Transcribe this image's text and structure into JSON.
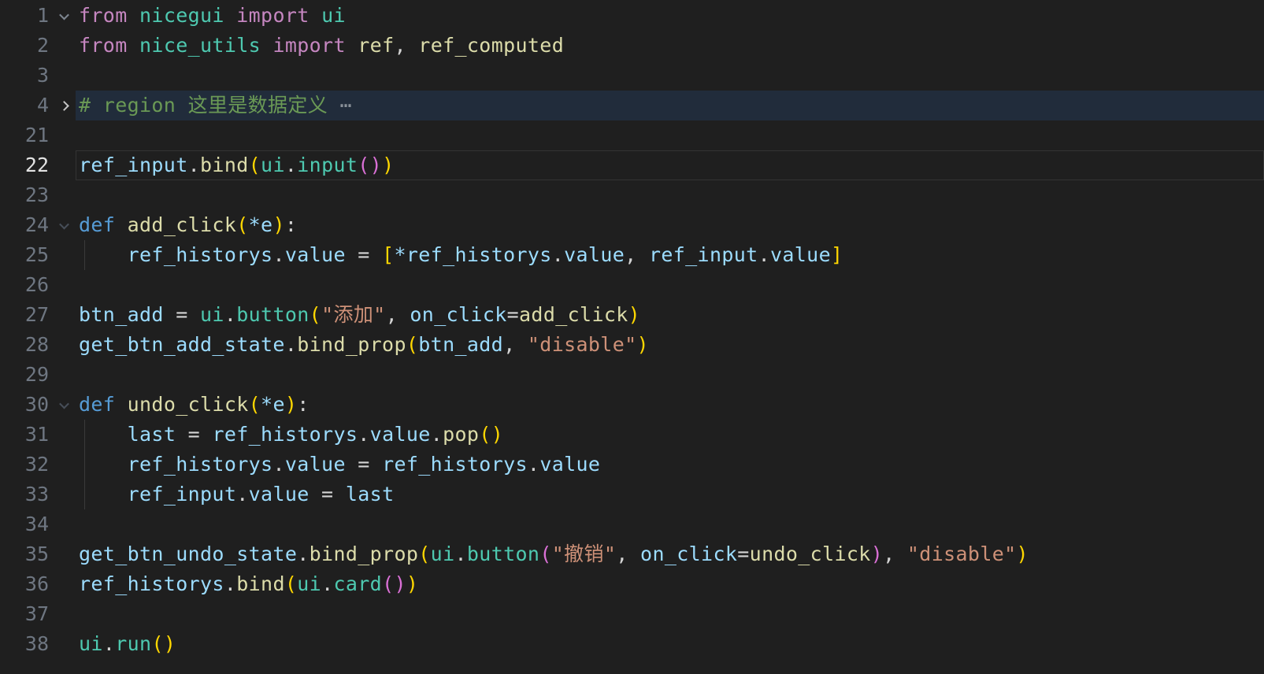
{
  "app": "code-editor",
  "language": "python",
  "colors": {
    "background": "#1f1f1f",
    "fold_region_highlight": "#212c3b",
    "current_line_border": "#343434",
    "line_number": "#6e7681",
    "active_line_number": "#e2e2e2",
    "indent_guide": "#3a3a3a"
  },
  "palette": {
    "kw": "#C586C0",
    "cls": "#4EC9B0",
    "fn": "#DCDCAA",
    "var": "#9CDCFE",
    "str": "#CE9178",
    "pn": "#D4D4D4",
    "cm": "#6A9955",
    "def": "#569CD6",
    "b1": "#FFD700",
    "b2": "#DA70D6",
    "fold": "#8a9199"
  },
  "editor": {
    "lines": [
      {
        "n": "1",
        "fold": "down",
        "foldStyle": "dim",
        "tokens": [
          {
            "c": "kw",
            "t": "from"
          },
          {
            "c": "pn",
            "t": " "
          },
          {
            "c": "cls",
            "t": "nicegui"
          },
          {
            "c": "pn",
            "t": " "
          },
          {
            "c": "kw",
            "t": "import"
          },
          {
            "c": "pn",
            "t": " "
          },
          {
            "c": "cls",
            "t": "ui"
          }
        ]
      },
      {
        "n": "2",
        "tokens": [
          {
            "c": "kw",
            "t": "from"
          },
          {
            "c": "pn",
            "t": " "
          },
          {
            "c": "cls",
            "t": "nice_utils"
          },
          {
            "c": "pn",
            "t": " "
          },
          {
            "c": "kw",
            "t": "import"
          },
          {
            "c": "pn",
            "t": " "
          },
          {
            "c": "fn",
            "t": "ref"
          },
          {
            "c": "pn",
            "t": ", "
          },
          {
            "c": "fn",
            "t": "ref_computed"
          }
        ]
      },
      {
        "n": "3",
        "tokens": []
      },
      {
        "n": "4",
        "fold": "right",
        "foldStyle": "bright",
        "highlight": true,
        "tokens": [
          {
            "c": "cm",
            "t": "# region 这里是数据定义"
          },
          {
            "c": "fold",
            "t": " ⋯"
          }
        ]
      },
      {
        "n": "21",
        "tokens": []
      },
      {
        "n": "22",
        "current": true,
        "tokens": [
          {
            "c": "var",
            "t": "ref_input"
          },
          {
            "c": "pn",
            "t": "."
          },
          {
            "c": "fn",
            "t": "bind"
          },
          {
            "c": "b1",
            "t": "("
          },
          {
            "c": "cls",
            "t": "ui"
          },
          {
            "c": "pn",
            "t": "."
          },
          {
            "c": "cls",
            "t": "input"
          },
          {
            "c": "b2",
            "t": "()"
          },
          {
            "c": "b1",
            "t": ")"
          }
        ]
      },
      {
        "n": "23",
        "tokens": []
      },
      {
        "n": "24",
        "fold": "down",
        "foldStyle": "faint",
        "tokens": [
          {
            "c": "def",
            "t": "def"
          },
          {
            "c": "pn",
            "t": " "
          },
          {
            "c": "fn",
            "t": "add_click"
          },
          {
            "c": "b1",
            "t": "("
          },
          {
            "c": "var",
            "t": "*e"
          },
          {
            "c": "b1",
            "t": ")"
          },
          {
            "c": "pn",
            "t": ":"
          }
        ]
      },
      {
        "n": "25",
        "guide": true,
        "tokens": [
          {
            "c": "pn",
            "t": "    "
          },
          {
            "c": "var",
            "t": "ref_historys"
          },
          {
            "c": "pn",
            "t": "."
          },
          {
            "c": "var",
            "t": "value"
          },
          {
            "c": "pn",
            "t": " = "
          },
          {
            "c": "b1",
            "t": "["
          },
          {
            "c": "var",
            "t": "*ref_historys"
          },
          {
            "c": "pn",
            "t": "."
          },
          {
            "c": "var",
            "t": "value"
          },
          {
            "c": "pn",
            "t": ", "
          },
          {
            "c": "var",
            "t": "ref_input"
          },
          {
            "c": "pn",
            "t": "."
          },
          {
            "c": "var",
            "t": "value"
          },
          {
            "c": "b1",
            "t": "]"
          }
        ]
      },
      {
        "n": "26",
        "tokens": []
      },
      {
        "n": "27",
        "tokens": [
          {
            "c": "var",
            "t": "btn_add"
          },
          {
            "c": "pn",
            "t": " = "
          },
          {
            "c": "cls",
            "t": "ui"
          },
          {
            "c": "pn",
            "t": "."
          },
          {
            "c": "cls",
            "t": "button"
          },
          {
            "c": "b1",
            "t": "("
          },
          {
            "c": "str",
            "t": "\"添加\""
          },
          {
            "c": "pn",
            "t": ", "
          },
          {
            "c": "var",
            "t": "on_click"
          },
          {
            "c": "pn",
            "t": "="
          },
          {
            "c": "fn",
            "t": "add_click"
          },
          {
            "c": "b1",
            "t": ")"
          }
        ]
      },
      {
        "n": "28",
        "tokens": [
          {
            "c": "var",
            "t": "get_btn_add_state"
          },
          {
            "c": "pn",
            "t": "."
          },
          {
            "c": "fn",
            "t": "bind_prop"
          },
          {
            "c": "b1",
            "t": "("
          },
          {
            "c": "var",
            "t": "btn_add"
          },
          {
            "c": "pn",
            "t": ", "
          },
          {
            "c": "str",
            "t": "\"disable\""
          },
          {
            "c": "b1",
            "t": ")"
          }
        ]
      },
      {
        "n": "29",
        "tokens": []
      },
      {
        "n": "30",
        "fold": "down",
        "foldStyle": "faint",
        "tokens": [
          {
            "c": "def",
            "t": "def"
          },
          {
            "c": "pn",
            "t": " "
          },
          {
            "c": "fn",
            "t": "undo_click"
          },
          {
            "c": "b1",
            "t": "("
          },
          {
            "c": "var",
            "t": "*e"
          },
          {
            "c": "b1",
            "t": ")"
          },
          {
            "c": "pn",
            "t": ":"
          }
        ]
      },
      {
        "n": "31",
        "guide": true,
        "tokens": [
          {
            "c": "pn",
            "t": "    "
          },
          {
            "c": "var",
            "t": "last"
          },
          {
            "c": "pn",
            "t": " = "
          },
          {
            "c": "var",
            "t": "ref_historys"
          },
          {
            "c": "pn",
            "t": "."
          },
          {
            "c": "var",
            "t": "value"
          },
          {
            "c": "pn",
            "t": "."
          },
          {
            "c": "fn",
            "t": "pop"
          },
          {
            "c": "b1",
            "t": "()"
          }
        ]
      },
      {
        "n": "32",
        "guide": true,
        "tokens": [
          {
            "c": "pn",
            "t": "    "
          },
          {
            "c": "var",
            "t": "ref_historys"
          },
          {
            "c": "pn",
            "t": "."
          },
          {
            "c": "var",
            "t": "value"
          },
          {
            "c": "pn",
            "t": " = "
          },
          {
            "c": "var",
            "t": "ref_historys"
          },
          {
            "c": "pn",
            "t": "."
          },
          {
            "c": "var",
            "t": "value"
          }
        ]
      },
      {
        "n": "33",
        "guide": true,
        "tokens": [
          {
            "c": "pn",
            "t": "    "
          },
          {
            "c": "var",
            "t": "ref_input"
          },
          {
            "c": "pn",
            "t": "."
          },
          {
            "c": "var",
            "t": "value"
          },
          {
            "c": "pn",
            "t": " = "
          },
          {
            "c": "var",
            "t": "last"
          }
        ]
      },
      {
        "n": "34",
        "tokens": []
      },
      {
        "n": "35",
        "tokens": [
          {
            "c": "var",
            "t": "get_btn_undo_state"
          },
          {
            "c": "pn",
            "t": "."
          },
          {
            "c": "fn",
            "t": "bind_prop"
          },
          {
            "c": "b1",
            "t": "("
          },
          {
            "c": "cls",
            "t": "ui"
          },
          {
            "c": "pn",
            "t": "."
          },
          {
            "c": "cls",
            "t": "button"
          },
          {
            "c": "b2",
            "t": "("
          },
          {
            "c": "str",
            "t": "\"撤销\""
          },
          {
            "c": "pn",
            "t": ", "
          },
          {
            "c": "var",
            "t": "on_click"
          },
          {
            "c": "pn",
            "t": "="
          },
          {
            "c": "fn",
            "t": "undo_click"
          },
          {
            "c": "b2",
            "t": ")"
          },
          {
            "c": "pn",
            "t": ", "
          },
          {
            "c": "str",
            "t": "\"disable\""
          },
          {
            "c": "b1",
            "t": ")"
          }
        ]
      },
      {
        "n": "36",
        "tokens": [
          {
            "c": "var",
            "t": "ref_historys"
          },
          {
            "c": "pn",
            "t": "."
          },
          {
            "c": "fn",
            "t": "bind"
          },
          {
            "c": "b1",
            "t": "("
          },
          {
            "c": "cls",
            "t": "ui"
          },
          {
            "c": "pn",
            "t": "."
          },
          {
            "c": "cls",
            "t": "card"
          },
          {
            "c": "b2",
            "t": "()"
          },
          {
            "c": "b1",
            "t": ")"
          }
        ]
      },
      {
        "n": "37",
        "tokens": []
      },
      {
        "n": "38",
        "tokens": [
          {
            "c": "cls",
            "t": "ui"
          },
          {
            "c": "pn",
            "t": "."
          },
          {
            "c": "cls",
            "t": "run"
          },
          {
            "c": "b1",
            "t": "()"
          }
        ]
      }
    ]
  }
}
